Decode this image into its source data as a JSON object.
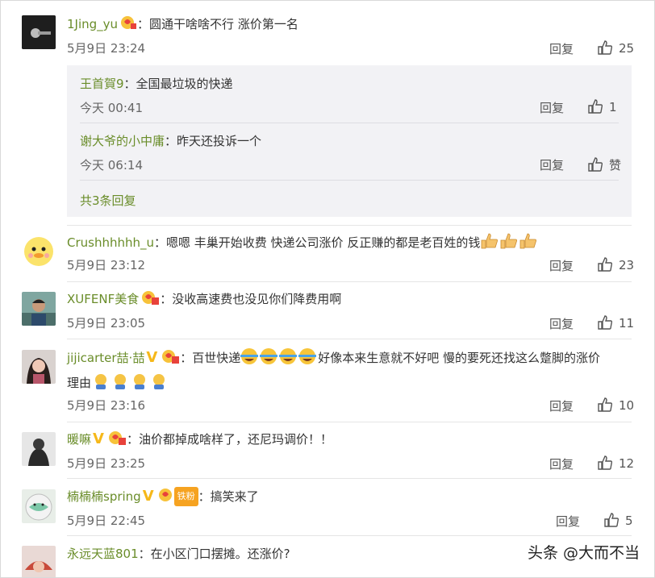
{
  "comments": [
    {
      "user": "1Jing_yu",
      "text": "：圆通干啥啥不行 涨价第一名",
      "time": "5月9日 23:24",
      "reply": "回复",
      "likes": "25"
    },
    {
      "user": "Crushhhhhh_u",
      "text": "：嗯嗯 丰巢开始收费 快递公司涨价 反正赚的都是老百姓的钱",
      "time": "5月9日 23:12",
      "reply": "回复",
      "likes": "23"
    },
    {
      "user": "XUFENF美食",
      "text": "：没收高速费也没见你们降费用啊",
      "time": "5月9日 23:05",
      "reply": "回复",
      "likes": "11"
    },
    {
      "user": "jijicarter喆·喆",
      "text_a": "：百世快递",
      "text_b": "好像本来生意就不好吧 慢的要死还找这么蹩脚的涨价",
      "text_c": "理由",
      "time": "5月9日 23:16",
      "reply": "回复",
      "likes": "10"
    },
    {
      "user": "暖嘛",
      "text": "：油价都掉成啥样了，还尼玛调价！！",
      "time": "5月9日 23:25",
      "reply": "回复",
      "likes": "12"
    },
    {
      "user": "楠楠楠spring",
      "badge": "铁粉",
      "text": "：搞笑来了",
      "time": "5月9日 22:45",
      "reply": "回复",
      "likes": "5"
    },
    {
      "user": "永远天蓝801",
      "text": "：在小区门口摆摊。还涨价?"
    }
  ],
  "subreplies": [
    {
      "user": "王首賀9",
      "text": "：全国最垃圾的快递",
      "time": "今天 00:41",
      "reply": "回复",
      "likes": "1"
    },
    {
      "user": "谢大爷的小中庸",
      "text": "：昨天还投诉一个",
      "time": "今天 06:14",
      "reply": "回复",
      "likes": "赞"
    }
  ],
  "more_replies": "共3条回复",
  "watermark": "头条 @大而不当",
  "colors": {
    "username": "#6a8d2a",
    "subbox": "#f2f2f5",
    "vbadge": "#f6b81a"
  }
}
